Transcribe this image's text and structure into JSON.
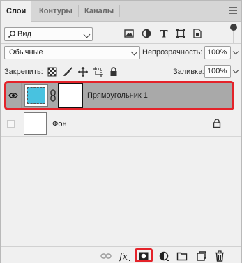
{
  "tabs": [
    {
      "label": "Слои",
      "active": true
    },
    {
      "label": "Контуры",
      "active": false
    },
    {
      "label": "Каналы",
      "active": false
    }
  ],
  "filter": {
    "kind_value": "Вид",
    "icons": [
      "pixel-filter-icon",
      "adjustment-filter-icon",
      "type-filter-icon",
      "shape-filter-icon",
      "smart-object-filter-icon"
    ],
    "toggle_on": true
  },
  "blend": {
    "mode_value": "Обычные",
    "opacity_label": "Непрозрачность:",
    "opacity_value": "100%"
  },
  "lock": {
    "label": "Закрепить:",
    "icons": [
      "lock-transparent-pixels-icon",
      "lock-image-pixels-icon",
      "lock-position-icon",
      "lock-artboard-icon",
      "lock-all-icon"
    ],
    "fill_label": "Заливка:",
    "fill_value": "100%"
  },
  "layers": [
    {
      "name": "Прямоугольник 1",
      "visible": true,
      "selected": true,
      "thumb_color": "#48c2e0",
      "has_mask": true
    },
    {
      "name": "Фон",
      "visible": false,
      "selected": false,
      "locked": true
    }
  ],
  "bottom_icons": [
    "link-layers-icon",
    "fx-icon",
    "add-mask-icon",
    "adjustment-layer-icon",
    "group-folder-icon",
    "new-layer-icon",
    "trash-icon"
  ],
  "colors": {
    "selection_outline": "#e4232a",
    "selected_row": "#a9a9a9",
    "shape_thumb": "#48c2e0"
  }
}
